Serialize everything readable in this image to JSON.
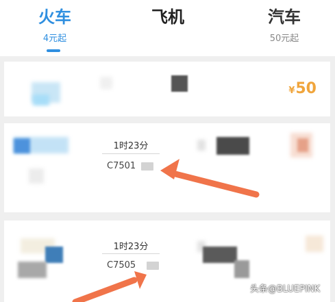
{
  "tabs": [
    {
      "label": "火车",
      "sub": "4元起"
    },
    {
      "label": "飞机",
      "sub": ""
    },
    {
      "label": "汽车",
      "sub": "50元起"
    }
  ],
  "summary": {
    "currency": "¥",
    "price": "50"
  },
  "trains": [
    {
      "duration": "1时23分",
      "number": "C7501"
    },
    {
      "duration": "1时23分",
      "number": "C7505"
    }
  ],
  "watermark": "头条@BLUEPINK",
  "colors": {
    "active_tab": "#2f8fe0",
    "price": "#f0a53c",
    "arrow": "#f0744a"
  }
}
